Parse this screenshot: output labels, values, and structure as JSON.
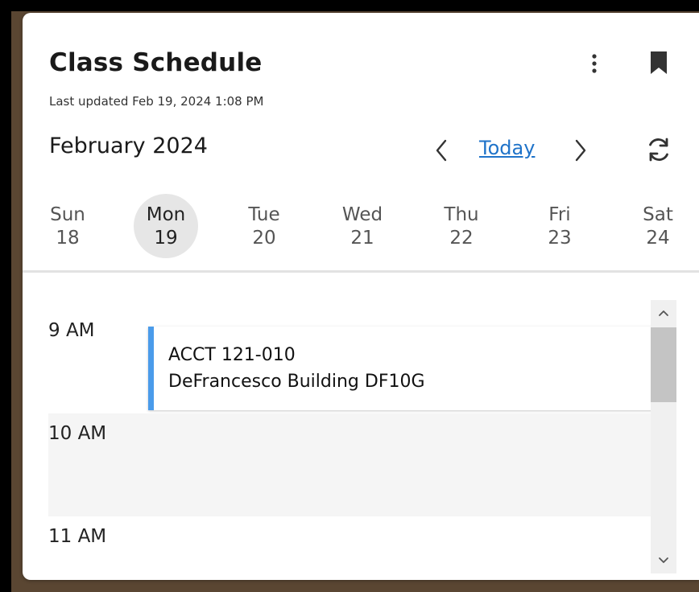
{
  "widget": {
    "title": "Class Schedule",
    "last_updated": "Last updated Feb 19, 2024 1:08 PM",
    "month": "February 2024",
    "today_label": "Today"
  },
  "days": [
    {
      "name": "Sun",
      "num": "18"
    },
    {
      "name": "Mon",
      "num": "19",
      "selected": true
    },
    {
      "name": "Tue",
      "num": "20"
    },
    {
      "name": "Wed",
      "num": "21"
    },
    {
      "name": "Thu",
      "num": "22"
    },
    {
      "name": "Fri",
      "num": "23"
    },
    {
      "name": "Sat",
      "num": "24"
    }
  ],
  "schedule": {
    "times": [
      "9 AM",
      "10 AM",
      "11 AM"
    ],
    "events": [
      {
        "course": "ACCT 121-010",
        "location": "DeFrancesco Building DF10G"
      }
    ]
  },
  "icons": {
    "more": "more-vertical-icon",
    "bookmark": "bookmark-icon",
    "prev": "chevron-left-icon",
    "next": "chevron-right-icon",
    "refresh": "refresh-icon"
  },
  "colors": {
    "accent": "#1f73c9",
    "event_bar": "#4a9bea",
    "selected_day": "#e6e6e6"
  }
}
